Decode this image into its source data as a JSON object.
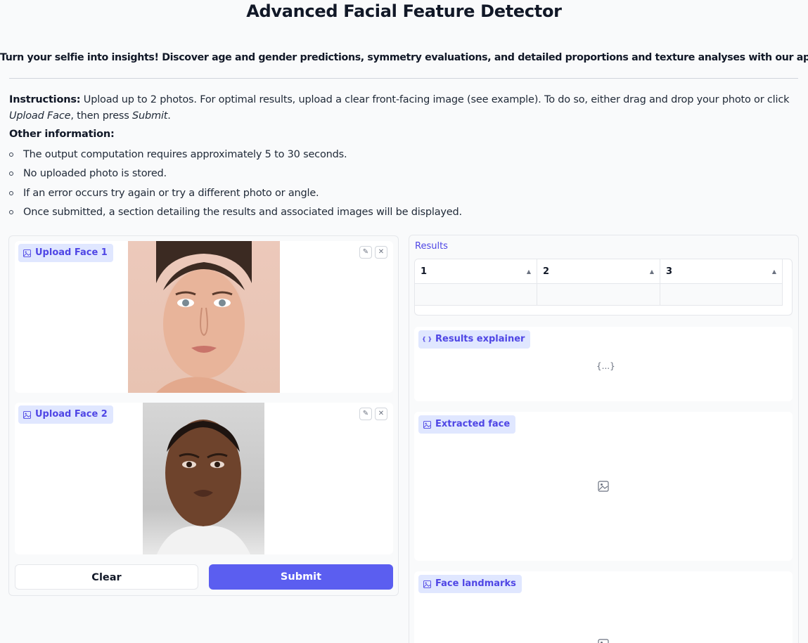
{
  "header": {
    "title": "Advanced Facial Feature Detector",
    "subtitle": "Turn your selfie into insights! Discover age and gender predictions, symmetry evaluations, and detailed proportions and texture analyses with our app."
  },
  "instructions": {
    "label": "Instructions:",
    "text_a": " Upload up to 2 photos. For optimal results, upload a clear front-facing image (see example). To do so, either drag and drop your photo or click ",
    "emph_upload": "Upload Face",
    "text_b": ", then press ",
    "emph_submit": "Submit",
    "text_c": "."
  },
  "other_info": {
    "title": "Other information:",
    "items": [
      "The output computation requires approximately 5 to 30 seconds.",
      "No uploaded photo is stored.",
      "If an error occurs try again or try a different photo or angle.",
      "Once submitted, a section detailing the results and associated images will be displayed."
    ]
  },
  "inputs": {
    "upload_face_1": {
      "label": "Upload Face 1",
      "icon": "image-icon"
    },
    "upload_face_2": {
      "label": "Upload Face 2",
      "icon": "image-icon"
    },
    "edit_icon": "✎",
    "close_icon": "✕"
  },
  "actions": {
    "clear_label": "Clear",
    "submit_label": "Submit"
  },
  "outputs": {
    "results_label": "Results",
    "table_headers": [
      "1",
      "2",
      "3"
    ],
    "sort_icon": "▲",
    "explainer_label": "Results explainer",
    "explainer_icon": "{ }",
    "json_placeholder": "{...}",
    "extracted_face_label": "Extracted face",
    "face_landmarks_label": "Face landmarks"
  },
  "colors": {
    "accent": "#5b5ef0",
    "chip_bg": "#e0e7ff",
    "chip_text": "#4f46e5"
  }
}
